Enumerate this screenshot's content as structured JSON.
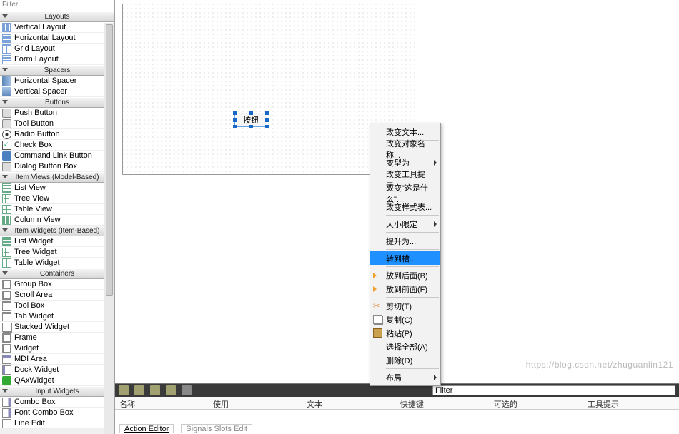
{
  "filter_placeholder": "Filter",
  "categories": [
    {
      "title": "Layouts",
      "items": [
        {
          "label": "Vertical Layout",
          "icon": "i-v"
        },
        {
          "label": "Horizontal Layout",
          "icon": "i-h"
        },
        {
          "label": "Grid Layout",
          "icon": "i-grid"
        },
        {
          "label": "Form Layout",
          "icon": "i-form"
        }
      ]
    },
    {
      "title": "Spacers",
      "items": [
        {
          "label": "Horizontal Spacer",
          "icon": "i-hs"
        },
        {
          "label": "Vertical Spacer",
          "icon": "i-vs"
        }
      ]
    },
    {
      "title": "Buttons",
      "items": [
        {
          "label": "Push Button",
          "icon": "i-btn"
        },
        {
          "label": "Tool Button",
          "icon": "i-btn"
        },
        {
          "label": "Radio Button",
          "icon": "i-radio"
        },
        {
          "label": "Check Box",
          "icon": "i-check"
        },
        {
          "label": "Command Link Button",
          "icon": "i-link"
        },
        {
          "label": "Dialog Button Box",
          "icon": "i-dbx"
        }
      ]
    },
    {
      "title": "Item Views (Model-Based)",
      "items": [
        {
          "label": "List View",
          "icon": "i-list"
        },
        {
          "label": "Tree View",
          "icon": "i-tree"
        },
        {
          "label": "Table View",
          "icon": "i-table"
        },
        {
          "label": "Column View",
          "icon": "i-col"
        }
      ]
    },
    {
      "title": "Item Widgets (Item-Based)",
      "items": [
        {
          "label": "List Widget",
          "icon": "i-list"
        },
        {
          "label": "Tree Widget",
          "icon": "i-tree"
        },
        {
          "label": "Table Widget",
          "icon": "i-table"
        }
      ]
    },
    {
      "title": "Containers",
      "items": [
        {
          "label": "Group Box",
          "icon": "i-frame"
        },
        {
          "label": "Scroll Area",
          "icon": "i-frame"
        },
        {
          "label": "Tool Box",
          "icon": "i-tab"
        },
        {
          "label": "Tab Widget",
          "icon": "i-tab"
        },
        {
          "label": "Stacked Widget",
          "icon": "i-stack"
        },
        {
          "label": "Frame",
          "icon": "i-frame"
        },
        {
          "label": "Widget",
          "icon": "i-frame"
        },
        {
          "label": "MDI Area",
          "icon": "i-mdi"
        },
        {
          "label": "Dock Widget",
          "icon": "i-dock"
        },
        {
          "label": "QAxWidget",
          "icon": "i-ax"
        }
      ]
    },
    {
      "title": "Input Widgets",
      "items": [
        {
          "label": "Combo Box",
          "icon": "i-combo"
        },
        {
          "label": "Font Combo Box",
          "icon": "i-combo"
        },
        {
          "label": "Line Edit",
          "icon": "i-line"
        }
      ]
    }
  ],
  "canvas": {
    "button_label": "按钮"
  },
  "context_menu": [
    {
      "label": "改变文本...",
      "type": "item"
    },
    {
      "type": "sep"
    },
    {
      "label": "改变对象名称...",
      "type": "item"
    },
    {
      "label": "变型为",
      "type": "submenu"
    },
    {
      "type": "sep"
    },
    {
      "label": "改变工具提示...",
      "type": "item"
    },
    {
      "label": "改变\"这是什么\"...",
      "type": "item"
    },
    {
      "label": "改变样式表...",
      "type": "item"
    },
    {
      "type": "sep"
    },
    {
      "label": "大小限定",
      "type": "submenu"
    },
    {
      "type": "sep"
    },
    {
      "label": "提升为...",
      "type": "item"
    },
    {
      "type": "sep"
    },
    {
      "label": "转到槽...",
      "type": "item",
      "highlight": true
    },
    {
      "type": "sep"
    },
    {
      "label": "放到后面(B)",
      "type": "item",
      "icon": "note"
    },
    {
      "label": "放到前面(F)",
      "type": "item",
      "icon": "note"
    },
    {
      "type": "sep"
    },
    {
      "label": "剪切(T)",
      "type": "item",
      "icon": "scissors"
    },
    {
      "label": "复制(C)",
      "type": "item",
      "icon": "copy"
    },
    {
      "label": "粘贴(P)",
      "type": "item",
      "icon": "paste"
    },
    {
      "label": "选择全部(A)",
      "type": "item"
    },
    {
      "label": "删除(D)",
      "type": "item"
    },
    {
      "type": "sep"
    },
    {
      "label": "布局",
      "type": "submenu"
    }
  ],
  "action_editor": {
    "filter_placeholder": "Filter",
    "columns": [
      "名称",
      "使用",
      "文本",
      "快捷键",
      "可选的",
      "工具提示"
    ],
    "tabs": [
      "Action Editor",
      "Signals Slots Edit"
    ]
  },
  "watermark": "https://blog.csdn.net/zhuguanlin121"
}
